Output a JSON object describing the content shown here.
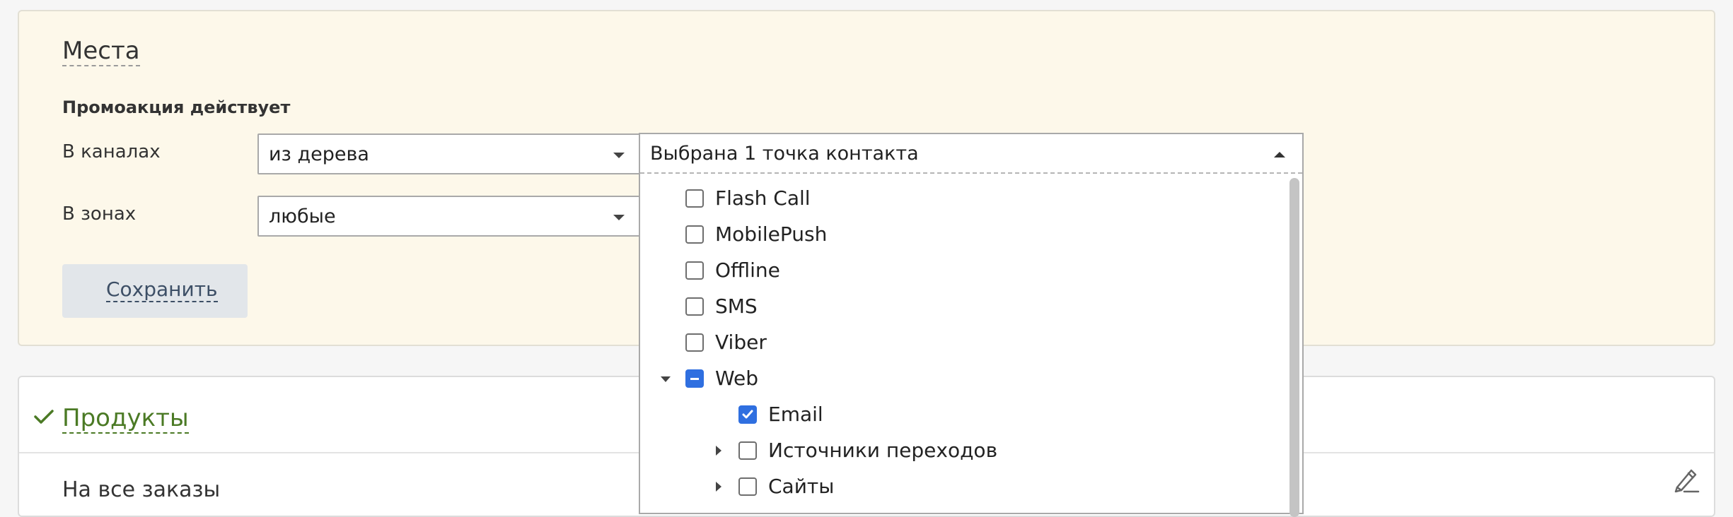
{
  "places": {
    "title": "Места",
    "subtitle": "Промоакция действует",
    "channels_label": "В каналах",
    "channels_value": "из дерева",
    "zones_label": "В зонах",
    "zones_value": "любые",
    "save_label": "Сохранить"
  },
  "contacts_dropdown": {
    "value": "Выбрана 1 точка контакта",
    "items": [
      {
        "label": "Flash Call",
        "state": "unchecked"
      },
      {
        "label": "MobilePush",
        "state": "unchecked"
      },
      {
        "label": "Offline",
        "state": "unchecked"
      },
      {
        "label": "SMS",
        "state": "unchecked"
      },
      {
        "label": "Viber",
        "state": "unchecked"
      },
      {
        "label": "Web",
        "state": "indeterminate",
        "expanded": true
      },
      {
        "label": "Email",
        "state": "checked"
      },
      {
        "label": "Источники переходов",
        "state": "unchecked",
        "expanded": false
      },
      {
        "label": "Сайты",
        "state": "unchecked",
        "expanded": false
      }
    ]
  },
  "products": {
    "title": "Продукты",
    "all_orders": "На все заказы"
  },
  "icons": {
    "status": "check-icon",
    "edit": "pencil-icon"
  },
  "colors": {
    "accent_blue": "#2f6fe0",
    "success_green": "#4b7a25",
    "panel_background": "#fdf8ea"
  }
}
